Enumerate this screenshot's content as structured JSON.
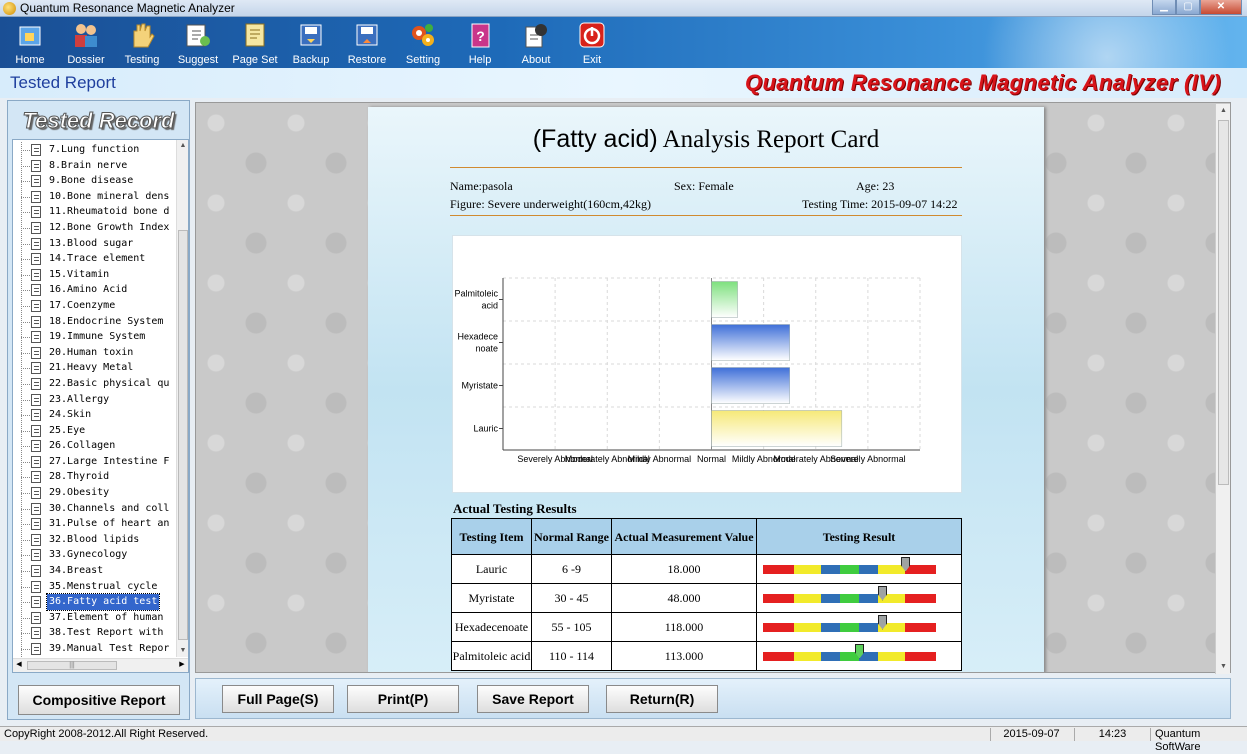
{
  "window": {
    "title": "Quantum Resonance Magnetic Analyzer"
  },
  "toolbar": {
    "items": [
      {
        "label": "Home",
        "icon": "home-icon"
      },
      {
        "label": "Dossier",
        "icon": "people-icon"
      },
      {
        "label": "Testing",
        "icon": "hand-icon"
      },
      {
        "label": "Suggest",
        "icon": "suggest-icon"
      },
      {
        "label": "Page Set",
        "icon": "page-set-icon"
      },
      {
        "label": "Backup",
        "icon": "backup-icon"
      },
      {
        "label": "Restore",
        "icon": "restore-icon"
      },
      {
        "label": "Setting",
        "icon": "gears-icon"
      },
      {
        "label": "Help",
        "icon": "help-book-icon"
      },
      {
        "label": "About",
        "icon": "about-icon"
      },
      {
        "label": "Exit",
        "icon": "power-icon"
      }
    ]
  },
  "header": {
    "section": "Tested Report",
    "brand": "Quantum Resonance Magnetic Analyzer (IV)"
  },
  "sidebar": {
    "title": "Tested Record",
    "items": [
      "7.Lung function",
      "8.Brain nerve",
      "9.Bone disease",
      "10.Bone mineral dens",
      "11.Rheumatoid bone d",
      "12.Bone Growth Index",
      "13.Blood sugar",
      "14.Trace element",
      "15.Vitamin",
      "16.Amino Acid",
      "17.Coenzyme",
      "18.Endocrine System",
      "19.Immune System",
      "20.Human toxin",
      "21.Heavy Metal",
      "22.Basic physical qu",
      "23.Allergy",
      "24.Skin",
      "25.Eye",
      "26.Collagen",
      "27.Large Intestine F",
      "28.Thyroid",
      "29.Obesity",
      "30.Channels and coll",
      "31.Pulse of heart an",
      "32.Blood lipids",
      "33.Gynecology",
      "34.Breast",
      "35.Menstrual cycle",
      "36.Fatty acid test",
      "37.Element of human",
      "38.Test Report with",
      "39.Manual Test Repor"
    ],
    "selected_index": 29,
    "compositive_label": "Compositive Report"
  },
  "report": {
    "title_paren": "(Fatty acid)",
    "title_rest": " Analysis Report Card",
    "name": "Name:pasola",
    "sex": "Sex: Female",
    "age": "Age: 23",
    "figure": "Figure: Severe underweight(160cm,42kg)",
    "testing_time": "Testing Time: 2015-09-07 14:22",
    "results_title": "Actual Testing Results",
    "col_item": "Testing Item",
    "col_range": "Normal Range",
    "col_value": "Actual Measurement Value",
    "col_result": "Testing Result",
    "rows": [
      {
        "item": "Lauric",
        "range": "6 -9",
        "value": "18.000",
        "level": 0.74
      },
      {
        "item": "Myristate",
        "range": "30 - 45",
        "value": "48.000",
        "level": 0.62
      },
      {
        "item": "Hexadecenoate",
        "range": "55 - 105",
        "value": "118.000",
        "level": 0.62
      },
      {
        "item": "Palmitoleic acid",
        "range": "110 - 114",
        "value": "113.000",
        "level": 0.5
      }
    ]
  },
  "chart_data": {
    "type": "bar",
    "categories": [
      "Palmitoleic acid",
      "Hexadecenoate",
      "Myristate",
      "Lauric"
    ],
    "category_labels": [
      [
        "Palmitoleic",
        "acid"
      ],
      [
        "Hexadece",
        "noate"
      ],
      [
        "Myristate"
      ],
      [
        "Lauric"
      ]
    ],
    "values": [
      0.5,
      1.5,
      1.5,
      2.5
    ],
    "xlim": [
      -4,
      4
    ],
    "x_tick_labels": [
      "Severely Abnormal",
      "Moderately Abnormal",
      "Mildly Abnormal",
      "Normal",
      "Mildly Abnormal",
      "Moderately Abnormal",
      "Severely Abnormal"
    ],
    "grid": true,
    "colors": [
      "#7ee07e",
      "#3e6fd8",
      "#3e6fd8",
      "#f6e978"
    ]
  },
  "bottom": {
    "full_page": "Full Page(S)",
    "print": "Print(P)",
    "save": "Save Report",
    "return": "Return(R)"
  },
  "status": {
    "copyright": "CopyRight 2008-2012.All Right Reserved.",
    "date": "2015-09-07",
    "time": "14:23",
    "company": "Quantum SoftWare"
  },
  "colors": {
    "brand": "#d8141a",
    "toolbar": "#1e6ab8",
    "header_text": "#1f3f9e",
    "selected": "#3366cc"
  }
}
